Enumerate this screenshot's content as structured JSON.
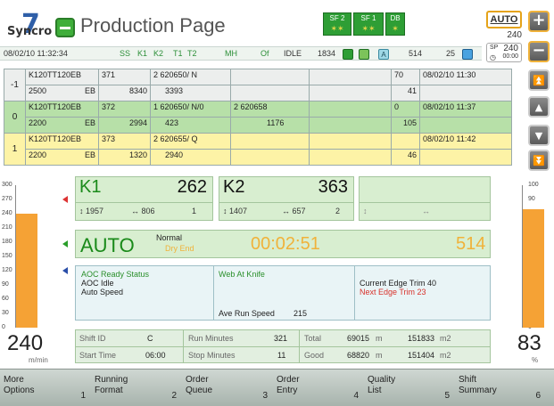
{
  "header": {
    "logo_text": "Syncro",
    "logo_mark": "7",
    "title": "Production Page",
    "sf_boxes": [
      {
        "top": "SF 2",
        "bottom": "✶✶"
      },
      {
        "top": "SF 1",
        "bottom": "✶✶"
      },
      {
        "top": "DB",
        "bottom": "✶"
      }
    ],
    "auto_label": "AUTO",
    "speed_display": "240",
    "sp_label": "SP",
    "sp_value": "240",
    "sp_time": "00:00"
  },
  "status_bar": {
    "datetime": "08/02/10 11:32:34",
    "ss": "SS",
    "k1": "K1",
    "k2": "K2",
    "t1": "T1",
    "t2": "T2",
    "mh": "MH",
    "of": "Of",
    "state": "IDLE",
    "num1": "1834",
    "a_label": "A",
    "num2": "514",
    "num3": "25"
  },
  "orders": [
    {
      "index": "-1",
      "code": "K120TT120EB",
      "qty": "2500",
      "flute": "EB",
      "id": "371",
      "len": "8340",
      "spec": "2  620650/ N",
      "spec_len": "3393",
      "spec2": "",
      "spec2_len": "",
      "count": "70",
      "count2": "41",
      "time": "08/02/10 11:30"
    },
    {
      "index": "0",
      "code": "K120TT120EB",
      "qty": "2200",
      "flute": "EB",
      "id": "372",
      "len": "2994",
      "spec": "1  620650/ N/0",
      "spec_len": "423",
      "spec2": "2  620658",
      "spec2_len": "1176",
      "count": "0",
      "count2": "105",
      "time": "08/02/10 11:37"
    },
    {
      "index": "1",
      "code": "K120TT120EB",
      "qty": "2200",
      "flute": "EB",
      "id": "373",
      "len": "1320",
      "spec": "2  620655/ Q",
      "spec_len": "2940",
      "spec2": "",
      "spec2_len": "",
      "count": "",
      "count2": "46",
      "time": "08/02/10 11:42"
    }
  ],
  "left_gauge": {
    "ticks": [
      "300",
      "270",
      "240",
      "210",
      "180",
      "150",
      "120",
      "90",
      "60",
      "30",
      "0"
    ],
    "value": "240",
    "unit": "m/min",
    "level": 0.8
  },
  "right_gauge": {
    "ticks": [
      "100",
      "90",
      "80",
      "70",
      "60",
      "50",
      "40",
      "30",
      "20",
      "10",
      "0"
    ],
    "value": "83",
    "unit": "%",
    "level": 0.83
  },
  "knives": [
    {
      "name": "K1",
      "value": "262",
      "a": "1957",
      "b": "806",
      "c": "1"
    },
    {
      "name": "K2",
      "value": "363",
      "a": "1407",
      "b": "657",
      "c": "2"
    },
    {
      "name": "",
      "value": "",
      "a": "",
      "b": "",
      "c": ""
    }
  ],
  "auto_row": {
    "mode": "AUTO",
    "normal": "Normal",
    "dry_end": "Dry End",
    "timer": "00:02:51",
    "value": "514"
  },
  "info": {
    "aoc_status": "AOC Ready Status",
    "aoc_idle": "AOC Idle",
    "auto_speed": "Auto Speed",
    "web_at_knife": "Web At Knife",
    "ave_run_speed_label": "Ave Run Speed",
    "ave_run_speed": "215",
    "current_trim": "Current Edge Trim 40",
    "next_trim": "Next Edge Trim 23"
  },
  "stats": {
    "shift_id_label": "Shift ID",
    "shift_id": "C",
    "run_minutes_label": "Run Minutes",
    "run_minutes": "321",
    "total_label": "Total",
    "total_m": "69015",
    "total_unit_m": "m",
    "total_m2": "151833",
    "total_unit_m2": "m2",
    "start_time_label": "Start Time",
    "start_time": "06:00",
    "stop_minutes_label": "Stop Minutes",
    "stop_minutes": "11",
    "good_label": "Good",
    "good_m": "68820",
    "good_unit_m": "m",
    "good_m2": "151404",
    "good_unit_m2": "m2"
  },
  "footer": [
    {
      "line1": "More",
      "line2": "Options",
      "num": "1"
    },
    {
      "line1": "Running",
      "line2": "Format",
      "num": "2"
    },
    {
      "line1": "Order",
      "line2": "Queue",
      "num": "3"
    },
    {
      "line1": "Order",
      "line2": "Entry",
      "num": "4"
    },
    {
      "line1": "Quality",
      "line2": "List",
      "num": "5"
    },
    {
      "line1": "Shift",
      "line2": "Summary",
      "num": "6"
    }
  ],
  "colors": {
    "accent_orange": "#f5a235",
    "green_panel": "#d8eed0",
    "row_green": "#b7e0a8",
    "row_yellow": "#fdf3a6"
  }
}
